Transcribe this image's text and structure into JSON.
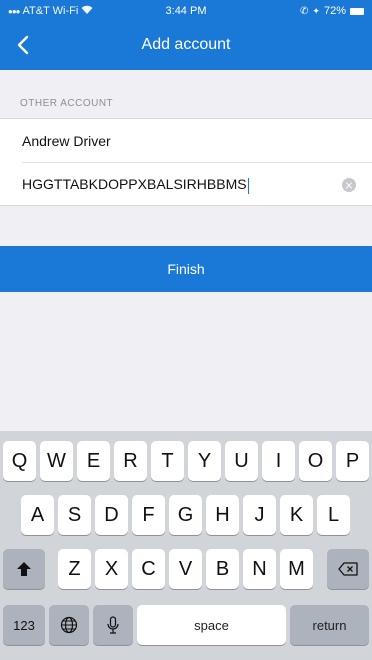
{
  "status": {
    "carrier": "AT&T Wi-Fi",
    "time": "3:44 PM",
    "battery": "72%"
  },
  "nav": {
    "title": "Add account"
  },
  "section": {
    "header": "OTHER ACCOUNT"
  },
  "form": {
    "account_name": "Andrew Driver",
    "secret_key": "HGGTTABKDOPPXBALSIRHBBMS"
  },
  "actions": {
    "finish": "Finish"
  },
  "keyboard": {
    "row1": [
      "Q",
      "W",
      "E",
      "R",
      "T",
      "Y",
      "U",
      "I",
      "O",
      "P"
    ],
    "row2": [
      "A",
      "S",
      "D",
      "F",
      "G",
      "H",
      "J",
      "K",
      "L"
    ],
    "row3": [
      "Z",
      "X",
      "C",
      "V",
      "B",
      "N",
      "M"
    ],
    "numbers": "123",
    "space": "space",
    "return": "return"
  },
  "colors": {
    "accent": "#1a78d6",
    "background": "#efeff4",
    "keyboard": "#d1d4d9"
  }
}
